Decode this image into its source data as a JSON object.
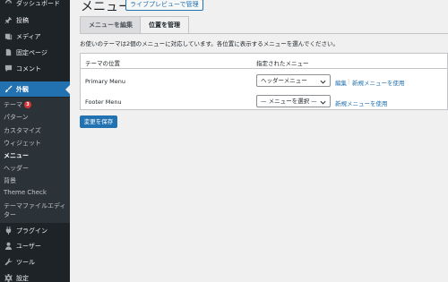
{
  "sidebar": {
    "dashboard": "ダッシュボード",
    "posts": "投稿",
    "media": "メディア",
    "pages": "固定ページ",
    "comments": "コメント",
    "appearance": "外観",
    "plugins": "プラグイン",
    "users": "ユーザー",
    "tools": "ツール",
    "settings": "設定",
    "submenu": {
      "themes": "テーマ",
      "themes_badge": "3",
      "patterns": "パターン",
      "customize": "カスタマイズ",
      "widgets": "ウィジェット",
      "menus": "メニュー",
      "header": "ヘッダー",
      "background": "背景",
      "theme_check": "Theme Check",
      "theme_editor_line1": "テーマファイルエディ",
      "theme_editor_line2": "ター"
    }
  },
  "header": {
    "title": "メニュー",
    "live_preview": "ライブプレビューで管理"
  },
  "tabs": {
    "edit": "メニューを編集",
    "locations": "位置を管理"
  },
  "intro_text": "お使いのテーマは2個のメニューに対応しています。各位置に表示するメニューを選んでください。",
  "table": {
    "col_location": "テーマの位置",
    "col_assigned": "指定されたメニュー",
    "rows": [
      {
        "label": "Primary Menu",
        "selected": "ヘッダーメニュー",
        "edit": "編集",
        "separator": "|",
        "new": "新規メニューを使用"
      },
      {
        "label": "Footer Menu",
        "selected": "— メニューを選択 —",
        "new": "新規メニューを使用"
      }
    ]
  },
  "save_button": "変更を保存",
  "colors": {
    "accent": "#2271b1",
    "sidebar_bg": "#1d2327",
    "submenu_bg": "#2c3338",
    "badge": "#d63638"
  }
}
